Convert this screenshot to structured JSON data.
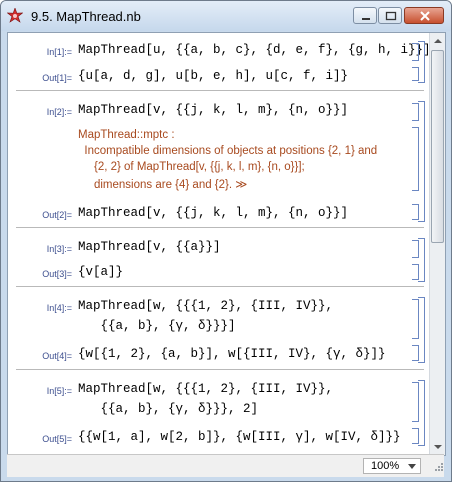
{
  "window": {
    "title": "9.5. MapThread.nb",
    "app_icon": "mathematica-star-icon"
  },
  "cells": [
    {
      "in_label": "In[1]:=",
      "in_code": "MapThread[u, {{a, b, c}, {d, e, f}, {g, h, i}}]",
      "out_label": "Out[1]=",
      "out_code": "{u[a, d, g], u[b, e, h], u[c, f, i]}"
    },
    {
      "in_label": "In[2]:=",
      "in_code": "MapThread[v, {{j, k, l, m}, {n, o}}]",
      "message": [
        "MapThread::mptc :",
        "  Incompatible dimensions of objects at positions {2, 1} and",
        "     {2, 2} of MapThread[v, {{j, k, l, m}, {n, o}}];",
        "     dimensions are {4} and {2}. ≫"
      ],
      "out_label": "Out[2]=",
      "out_code": "MapThread[v, {{j, k, l, m}, {n, o}}]"
    },
    {
      "in_label": "In[3]:=",
      "in_code": "MapThread[v, {{a}}]",
      "out_label": "Out[3]=",
      "out_code": "{v[a]}"
    },
    {
      "in_label": "In[4]:=",
      "in_code_lines": [
        "MapThread[w, {{{1, 2}, {III, IV}},",
        "   {{a, b}, {γ, δ}}}]"
      ],
      "out_label": "Out[4]=",
      "out_code": "{w[{1, 2}, {a, b}], w[{III, IV}, {γ, δ}]}"
    },
    {
      "in_label": "In[5]:=",
      "in_code_lines": [
        "MapThread[w, {{{1, 2}, {III, IV}},",
        "   {{a, b}, {γ, δ}}}, 2]"
      ],
      "out_label": "Out[5]=",
      "out_code": "{{w[1, a], w[2, b]}, {w[III, γ], w[IV, δ]}}"
    }
  ],
  "statusbar": {
    "zoom": "100%"
  },
  "colors": {
    "input_label": "#3d4f8f",
    "message": "#a84a1f",
    "cell_bracket": "#6b87c2"
  }
}
